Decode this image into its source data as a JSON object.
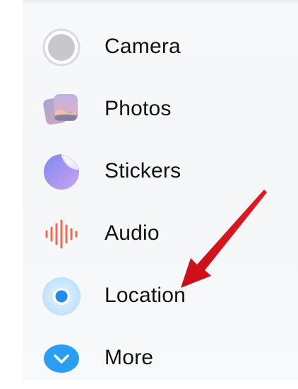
{
  "menu": {
    "items": [
      {
        "label": "Camera",
        "icon": "camera-icon"
      },
      {
        "label": "Photos",
        "icon": "photos-icon"
      },
      {
        "label": "Stickers",
        "icon": "stickers-icon"
      },
      {
        "label": "Audio",
        "icon": "audio-icon"
      },
      {
        "label": "Location",
        "icon": "location-icon"
      },
      {
        "label": "More",
        "icon": "more-icon"
      }
    ]
  },
  "annotation": {
    "arrow_color": "#e3121e",
    "points_to": "Location"
  },
  "colors": {
    "location_blue": "#1f8bf0",
    "more_blue": "#2a9df4",
    "audio_coral": "#f26a4f",
    "camera_gray": "#c8c8cc",
    "stickers_purple": "#8f8cf0"
  }
}
